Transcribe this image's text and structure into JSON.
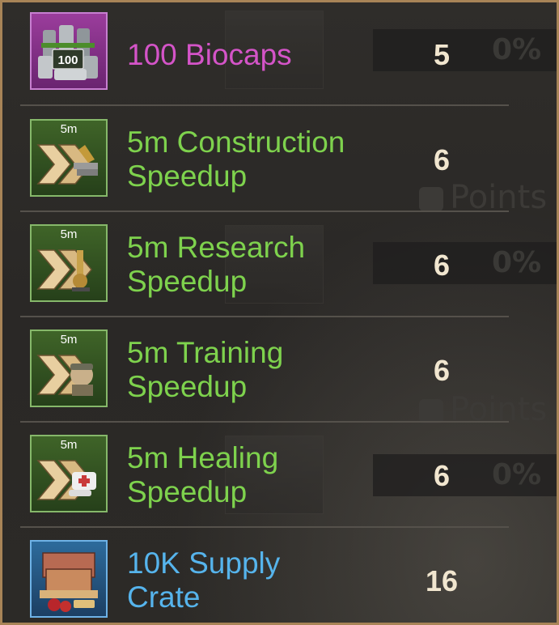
{
  "items": [
    {
      "name": "100 Biocaps",
      "quantity": "5",
      "rarity": "purple",
      "icon_text": "100",
      "icon": "biocaps-icon"
    },
    {
      "name": "5m Construction Speedup",
      "name_line1": "5m Construction",
      "name_line2": "Speedup",
      "quantity": "6",
      "rarity": "green",
      "time_label": "5m",
      "icon": "construction-speedup-icon"
    },
    {
      "name": "5m Research Speedup",
      "name_line1": "5m Research",
      "name_line2": "Speedup",
      "quantity": "6",
      "rarity": "green",
      "time_label": "5m",
      "icon": "research-speedup-icon"
    },
    {
      "name": "5m Training Speedup",
      "name_line1": "5m Training",
      "name_line2": "Speedup",
      "quantity": "6",
      "rarity": "green",
      "time_label": "5m",
      "icon": "training-speedup-icon"
    },
    {
      "name": "5m Healing Speedup",
      "name_line1": "5m Healing",
      "name_line2": "Speedup",
      "quantity": "6",
      "rarity": "green",
      "time_label": "5m",
      "icon": "healing-speedup-icon"
    },
    {
      "name": "10K Supply Crate",
      "name_line1": "10K Supply",
      "name_line2": "Crate",
      "quantity": "16",
      "rarity": "blue",
      "icon": "supply-crate-icon"
    }
  ],
  "background": {
    "percent_label": "0%",
    "points_label": "Points"
  },
  "colors": {
    "frame_border": "#a88457",
    "purple_text": "#d454c8",
    "green_text": "#7ed24d",
    "blue_text": "#56b4ec",
    "quantity_text": "#f1e6cf"
  }
}
